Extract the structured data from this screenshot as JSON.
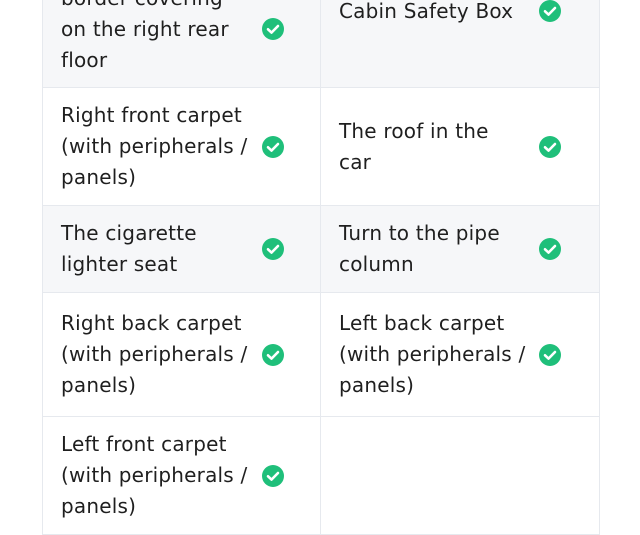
{
  "checklist": {
    "rows": [
      {
        "left": {
          "label": "border covering on the right rear floor",
          "checked": true
        },
        "right": {
          "label": "Cabin Safety Box",
          "checked": true
        }
      },
      {
        "left": {
          "label": "Right front carpet (with peripherals / panels)",
          "checked": true
        },
        "right": {
          "label": "The roof in the car",
          "checked": true
        }
      },
      {
        "left": {
          "label": "The cigarette lighter seat",
          "checked": true
        },
        "right": {
          "label": "Turn to the pipe column",
          "checked": true
        }
      },
      {
        "left": {
          "label": "Right back carpet (with peripherals / panels)",
          "checked": true
        },
        "right": {
          "label": "Left back carpet (with peripherals / panels)",
          "checked": true
        }
      },
      {
        "left": {
          "label": "Left front carpet (with peripherals / panels)",
          "checked": true
        },
        "right": {
          "label": "",
          "checked": false
        }
      }
    ]
  },
  "colors": {
    "check": "#1fbf7a",
    "border": "#e6e9ee",
    "shaded_row": "#f6f7f9",
    "text": "#1f1f1f"
  },
  "icons": {
    "checked": "check-circle-icon"
  }
}
